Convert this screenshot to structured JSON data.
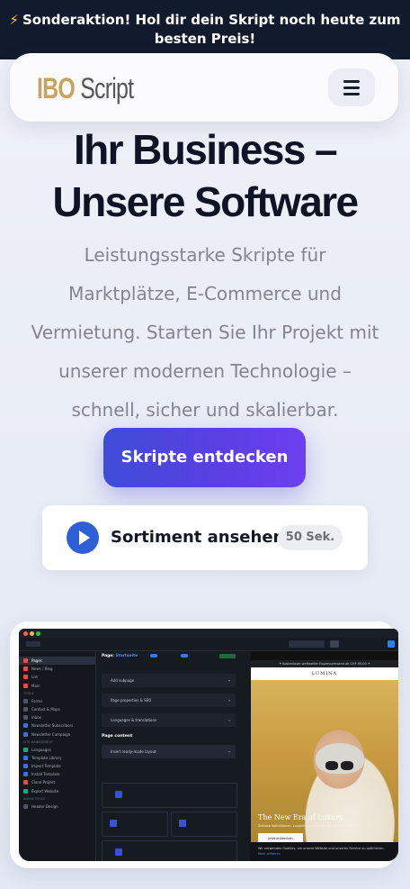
{
  "promo": {
    "icon": "lightning-bolt-icon",
    "text_line1": "Sonderaktion! Hol dir dein Skript noch heute zum",
    "text_line2": "besten Preis!"
  },
  "header": {
    "logo_part1": "IBO",
    "logo_part2": "Script",
    "menu_icon": "hamburger-menu-icon"
  },
  "hero": {
    "title_line1": "Ihr Business –",
    "title_line2": "Unsere Software",
    "subtitle_lines": [
      "Leistungsstarke Skripte für",
      "Marktplätze, E-Commerce und",
      "Vermietung. Starten Sie Ihr Projekt mit",
      "unserer modernen Technologie –",
      "schnell, sicher und skalierbar."
    ],
    "cta_label": "Skripte entdecken"
  },
  "video": {
    "label": "Sortiment ansehen",
    "duration": "50 Sek.",
    "icon": "play-icon"
  },
  "colors": {
    "promo_bg": "#121b2e",
    "cta_start": "#3f4dd9",
    "cta_end": "#6d3ff0",
    "play": "#2f5fd6",
    "logo_gold": "#c7a45a"
  },
  "preview": {
    "sidebar_sections": [
      {
        "header": "",
        "items": [
          {
            "label": "Pages",
            "active": true,
            "color": "#e0533d"
          },
          {
            "label": "News / Blog",
            "color": "#e0533d"
          },
          {
            "label": "List",
            "color": "#e0533d"
          },
          {
            "label": "Main",
            "color": "#e0533d"
          }
        ]
      },
      {
        "header": "TOOLS",
        "items": [
          {
            "label": "Forms",
            "color": "#4f5563"
          },
          {
            "label": "Contact & Maps",
            "color": "#4f5563"
          },
          {
            "label": "Inbox",
            "color": "#4f5563"
          },
          {
            "label": "Newsletter Subscribers",
            "color": "#3d6fd6"
          },
          {
            "label": "Newsletter Campaign",
            "color": "#3d6fd6"
          }
        ]
      },
      {
        "header": "SITE MANAGEMENT",
        "items": [
          {
            "label": "Languages",
            "color": "#19a58a"
          },
          {
            "label": "Template Library",
            "color": "#3d6fd6"
          },
          {
            "label": "Import Template",
            "color": "#3d6fd6"
          },
          {
            "label": "Install Template",
            "color": "#3d6fd6"
          },
          {
            "label": "Clone Project",
            "color": "#e0533d"
          },
          {
            "label": "Export Website",
            "color": "#19a58a"
          }
        ]
      },
      {
        "header": "ADMIN TOOLS",
        "items": [
          {
            "label": "Header Design",
            "color": "#4f5563"
          }
        ]
      }
    ],
    "editor_page_label": "Page:",
    "editor_page_name": "Startseite",
    "editor_accordions": [
      "Add subpage",
      "Page properties & SEO",
      "Languages & translations"
    ],
    "editor_section": "Page content",
    "editor_layout": "Insert ready-made layout",
    "site_banner": "✦ Kostenloser weltweiter Expressversand ab CHF 90.00 ✦",
    "site_logo": "LUMINA",
    "site_heading": "The New Era of Luxury.",
    "site_text": "Zeitlose Kollektionen. Langlebig. Entdecke die Sommer-Drop '24",
    "site_button": "Jetzt entdecken",
    "cookie_text": "Wir verwenden Cookies, um unsere Website und unseren Service zu optimieren.",
    "cookie_link": "Mehr erfahren"
  }
}
